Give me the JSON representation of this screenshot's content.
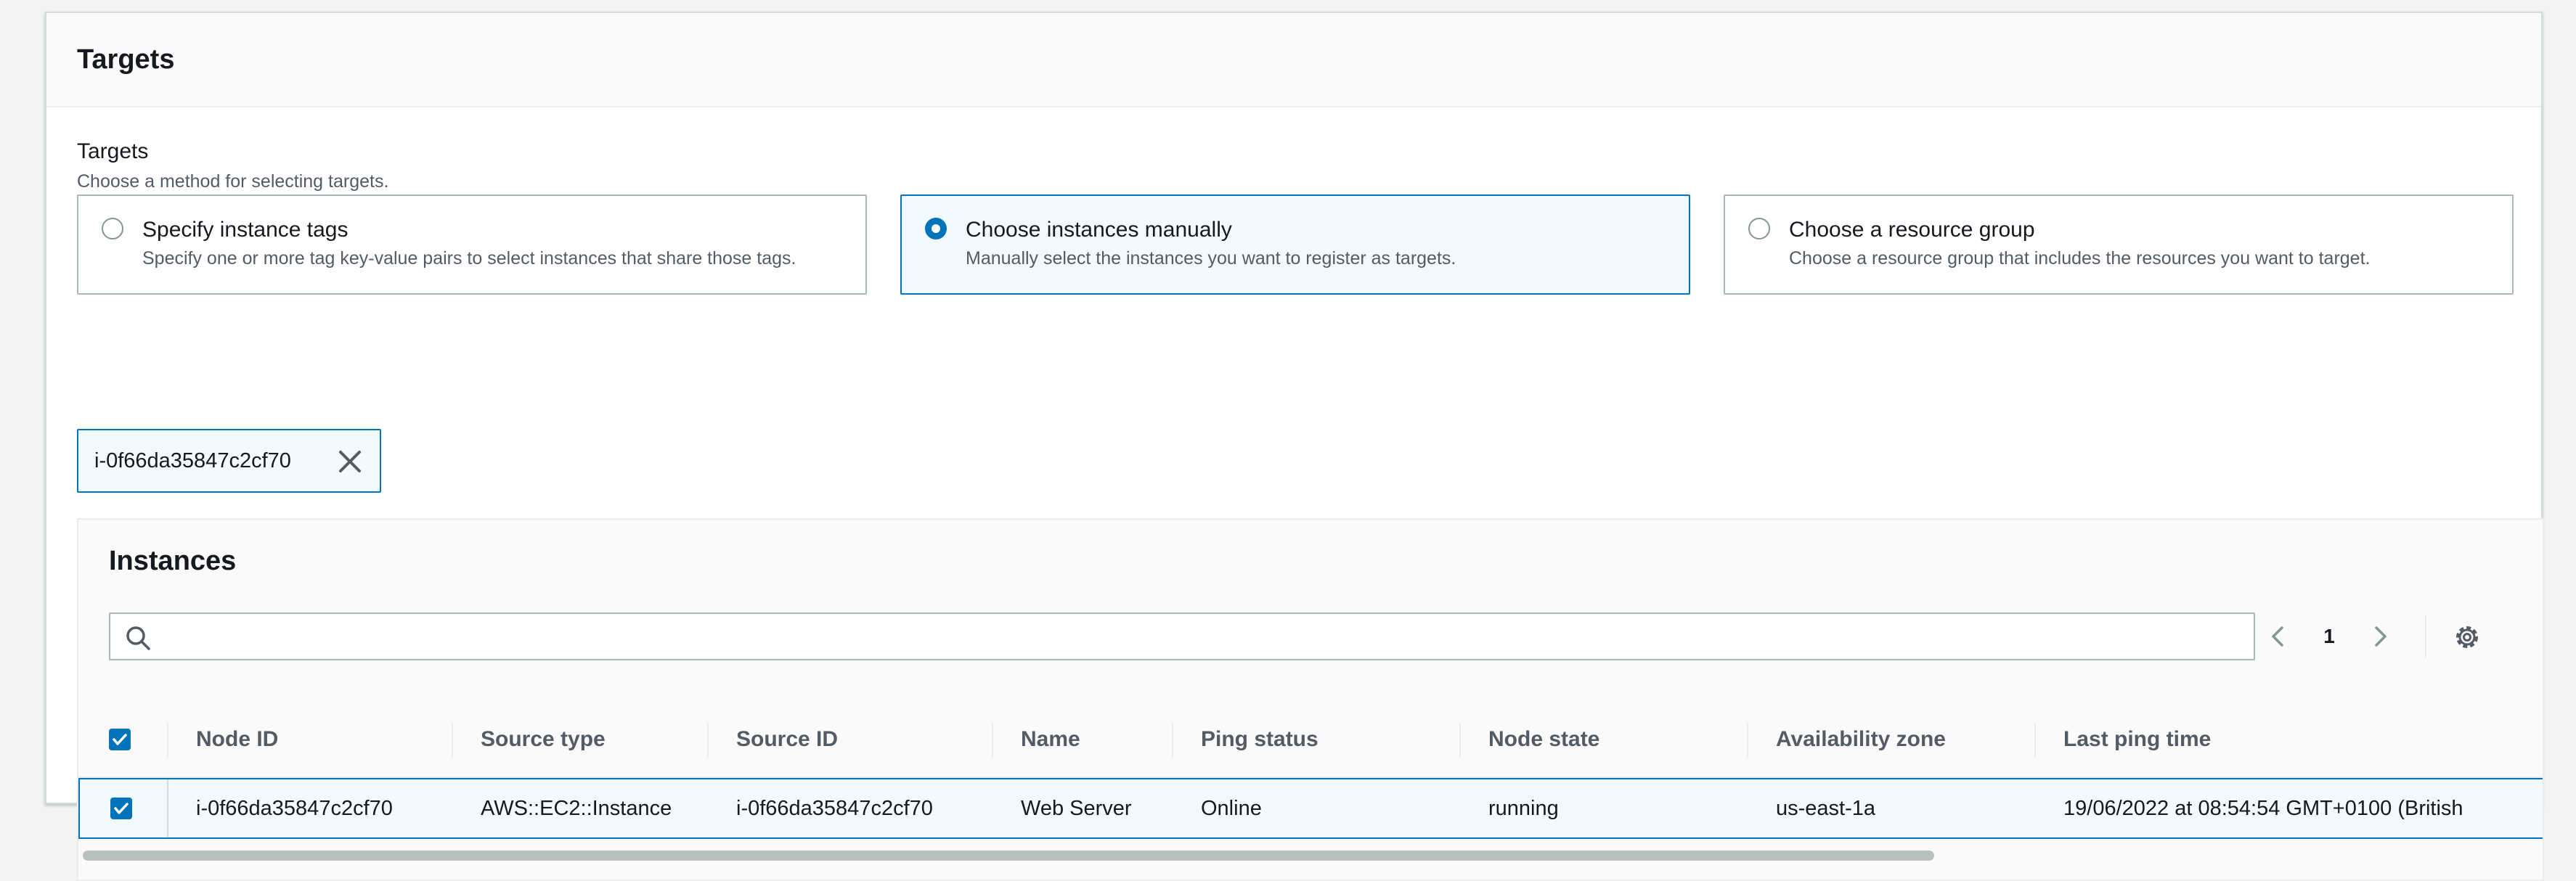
{
  "panel": {
    "title": "Targets"
  },
  "targets": {
    "label": "Targets",
    "description": "Choose a method for selecting targets.",
    "options": [
      {
        "title": "Specify instance tags",
        "description": "Specify one or more tag key-value pairs to select instances that share those tags.",
        "selected": false
      },
      {
        "title": "Choose instances manually",
        "description": "Manually select the instances you want to register as targets.",
        "selected": true
      },
      {
        "title": "Choose a resource group",
        "description": "Choose a resource group that includes the resources you want to target.",
        "selected": false
      }
    ]
  },
  "token": {
    "label": "i-0f66da35847c2cf70"
  },
  "instances": {
    "title": "Instances",
    "search_placeholder": "",
    "page": "1",
    "columns": [
      "Node ID",
      "Source type",
      "Source ID",
      "Name",
      "Ping status",
      "Node state",
      "Availability zone",
      "Last ping time"
    ],
    "rows": [
      {
        "node_id": "i-0f66da35847c2cf70",
        "source_type": "AWS::EC2::Instance",
        "source_id": "i-0f66da35847c2cf70",
        "name": "Web Server",
        "ping_status": "Online",
        "node_state": "running",
        "availability_zone": "us-east-1a",
        "last_ping_time": "19/06/2022 at 08:54:54 GMT+0100 (British"
      }
    ]
  },
  "colors": {
    "accent": "#0073bb",
    "selected_bg": "#f1faff",
    "border": "#aab7b8"
  },
  "icons": {
    "search": "search-icon",
    "settings": "gear-icon",
    "remove": "close-icon",
    "prev": "chevron-left-icon",
    "next": "chevron-right-icon"
  }
}
